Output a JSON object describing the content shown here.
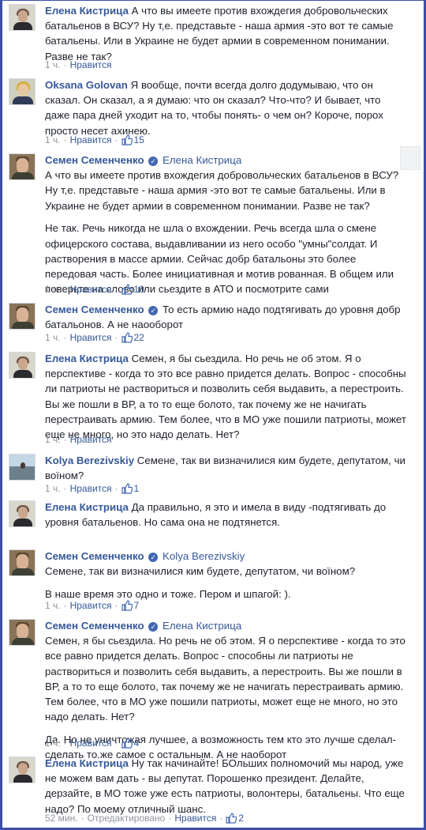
{
  "theme": {
    "link_color": "#365899",
    "meta_color": "#90949c",
    "text_color": "#1d2129",
    "verified_color": "#4267b2",
    "frame_color": "#3b4fa8"
  },
  "comments": [
    {
      "author": "Елена Кистрица",
      "text": [
        "А что вы имеете против вхождегия добровольческих батальенов в ВСУ? Ну т,е. представьте - наша армия -это вот те самые батальены. Или в Украине не будет армии в современном понимании. Разве не так?"
      ],
      "time": "1 ч.",
      "like_label": "Нравится"
    },
    {
      "author": "Oksana Golovan",
      "text": [
        "Я вообще, почти всегда долго додумываю, что он сказал. Он сказал, а я думаю: что он сказал? Что-что? И бывает, что даже пара дней уходит на то, чтобы понять- о чем он? Короче, порох просто несет ахинею."
      ],
      "time": "1 ч.",
      "like_label": "Нравится",
      "likes": "15"
    },
    {
      "author": "Семен Семенченко",
      "reply_to": "Елена Кистрица",
      "quote": "А что вы имеете против вхождегия добровольческих батальенов в ВСУ? Ну т,е. представьте - наша армия -это вот те самые батальены. Или в Украине не будет армии в современном понимании. Разве не так?",
      "text": [
        "Не так. Речь никогда не шла о вхождении. Речь всегда шла о смене офицерского состава, выдавливании из него особо \"умны\"солдат. И растворения в массе армии. Сейчас добр батальоны это более передовая часть. Более инициативная и мотив рованная. В общем или поверьте на слово или сьездите в АТО и посмотрите сами"
      ],
      "time": "1 ч.",
      "like_label": "Нравится",
      "likes": "10"
    },
    {
      "author": "Семен Семенченко",
      "text": [
        "То есть армию надо подтягивать до уровня добр батальонов. А не наооборот"
      ],
      "time": "1 ч.",
      "like_label": "Нравится",
      "likes": "22"
    },
    {
      "author": "Елена Кистрица",
      "text": [
        "Семен, я бы сьездила. Но речь не об этом. Я о перспективе - когда то это все равно придется делать. Вопрос - способны ли патриоты не раствориться и позволить себя выдавить, а перестроить. Вы же пошли в ВР, а то то еще болото, так почему же не начигать перестраивать армию. Тем более, что в МО уже пошили патриоты, может еще не много, но это надо делать. Нет?"
      ],
      "time": "1 ч.",
      "like_label": "Нравится"
    },
    {
      "author": "Kolya Berezivskiy",
      "text": [
        "Семене, так ви визначилися ким будете, депутатом, чи воїном?"
      ],
      "time": "1 ч.",
      "like_label": "Нравится",
      "likes": "1"
    },
    {
      "author": "Елена Кистрица",
      "text": [
        "Да правильно, я это и имела в виду -подтягивать до уровня батальенов. Но сама она не подтянется."
      ],
      "time": "1 ч.",
      "like_label": "Нравится"
    },
    {
      "author": "Семен Семенченко",
      "reply_to": "Kolya Berezivskiy",
      "quote": "Семене, так ви визначилися ким будете, депутатом, чи воїном?",
      "text": [
        "В наше время это одно и тоже. Пером и шпагой: )."
      ],
      "time": "1 ч.",
      "like_label": "Нравится",
      "likes": "7"
    },
    {
      "author": "Семен Семенченко",
      "reply_to": "Елена Кистрица",
      "quote": "Семен, я бы сьездила. Но речь не об этом. Я о перспективе - когда то это все равно придется делать. Вопрос - способны ли патриоты не раствориться и позволить себя выдавить, а перестроить. Вы же пошли в ВР, а то то еще болото, так почему же не начигать перестраивать армию. Тем более, что в МО уже пошили патриоты, может еще не много, но это надо делать. Нет?",
      "text": [
        "Да. Но не уничтожая лучшее, а возможность тем кто это лучше сделал- сделать то.же самое с остальным. А не наоборот"
      ],
      "time": "1 ч.",
      "like_label": "Нравится",
      "likes": "4"
    },
    {
      "author": "Елена Кистрица",
      "text": [
        "Ну так начинайте! БОльших полномочий мы народ, уже не можем вам дать - вы депутат. Порошенко президент. Делайте, дерзайте, в МО тоже уже есть патриоты, волонтеры, батальены. Что еще надо? По моему отличный шанс."
      ],
      "time": "52 мин.",
      "edited_label": "Отредактировано",
      "like_label": "Нравится",
      "likes": "2"
    }
  ]
}
